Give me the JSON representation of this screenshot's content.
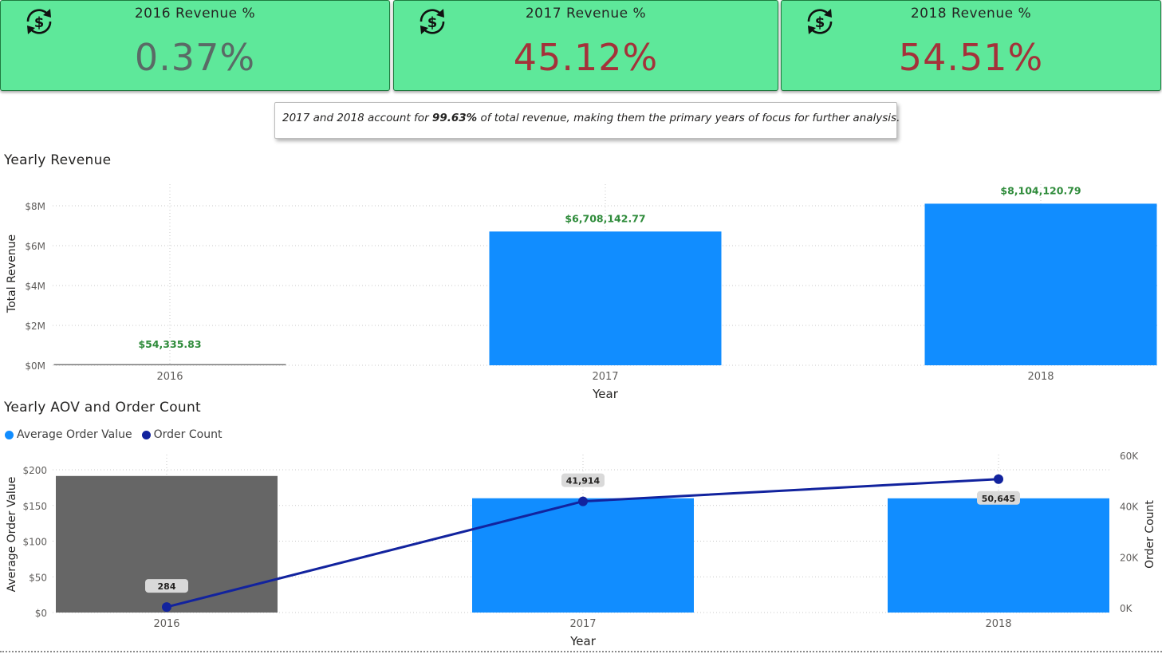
{
  "kpis": [
    {
      "title": "2016 Revenue %",
      "value": "0.37%",
      "color": "#5a6a66"
    },
    {
      "title": "2017 Revenue %",
      "value": "45.12%",
      "color": "#a4323a"
    },
    {
      "title": "2018 Revenue %",
      "value": "54.51%",
      "color": "#a4323a"
    }
  ],
  "note": {
    "before": "2017 and 2018 account for ",
    "highlight": "99.63%",
    "after": " of total revenue, making them the primary years of focus for further analysis."
  },
  "revenue_chart": {
    "title": "Yearly Revenue",
    "xlabel": "Year",
    "ylabel": "Total Revenue"
  },
  "aov_chart": {
    "title": "Yearly AOV and Order Count",
    "xlabel": "Year",
    "ylabel_left": "Average Order Value",
    "ylabel_right": "Order Count",
    "legend": [
      {
        "label": "Average Order Value",
        "color": "#118dff"
      },
      {
        "label": "Order Count",
        "color": "#12239e"
      }
    ]
  },
  "chart_data": [
    {
      "type": "bar",
      "title": "Yearly Revenue",
      "xlabel": "Year",
      "ylabel": "Total Revenue",
      "categories": [
        "2016",
        "2017",
        "2018"
      ],
      "values": [
        54335.83,
        6708142.77,
        8104120.79
      ],
      "data_labels": [
        "$54,335.83",
        "$6,708,142.77",
        "$8,104,120.79"
      ],
      "ylim": [
        0,
        9000000
      ],
      "yticks": [
        0,
        2000000,
        4000000,
        6000000,
        8000000
      ],
      "ytick_labels": [
        "$0M",
        "$2M",
        "$4M",
        "$6M",
        "$8M"
      ],
      "bar_color": "#118dff",
      "label_color": "#2e8b3a",
      "grid": true
    },
    {
      "type": "bar",
      "title": "Yearly AOV and Order Count",
      "xlabel": "Year",
      "categories": [
        "2016",
        "2017",
        "2018"
      ],
      "series": [
        {
          "name": "Average Order Value",
          "kind": "bar",
          "axis": "left",
          "values": [
            191.3,
            160.1,
            160.0
          ],
          "colors": [
            "#666666",
            "#118dff",
            "#118dff"
          ]
        },
        {
          "name": "Order Count",
          "kind": "line",
          "axis": "right",
          "values": [
            284,
            41914,
            50645
          ],
          "data_labels": [
            "284",
            "41,914",
            "50,645"
          ],
          "color": "#12239e"
        }
      ],
      "ylim_left": [
        0,
        200
      ],
      "yticks_left": [
        0,
        50,
        100,
        150,
        200
      ],
      "ytick_labels_left": [
        "$0",
        "$50",
        "$100",
        "$150",
        "$200"
      ],
      "ylim_right": [
        0,
        60000
      ],
      "yticks_right": [
        0,
        20000,
        40000,
        60000
      ],
      "ytick_labels_right": [
        "0K",
        "20K",
        "40K",
        "60K"
      ],
      "legend_position": "top-left",
      "grid": true
    }
  ]
}
